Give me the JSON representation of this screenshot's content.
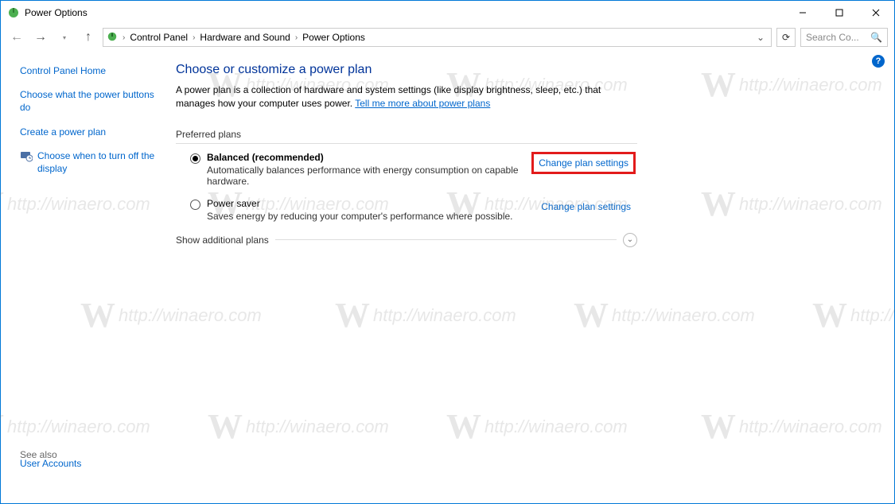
{
  "window": {
    "title": "Power Options"
  },
  "breadcrumb": {
    "seg1": "Control Panel",
    "seg2": "Hardware and Sound",
    "seg3": "Power Options"
  },
  "search": {
    "placeholder": "Search Co..."
  },
  "sidebar": {
    "home": "Control Panel Home",
    "link_buttons": "Choose what the power buttons do",
    "link_create": "Create a power plan",
    "link_turnoff": "Choose when to turn off the display",
    "see_also_label": "See also",
    "see_also_link": "User Accounts"
  },
  "content": {
    "heading": "Choose or customize a power plan",
    "desc_pre": "A power plan is a collection of hardware and system settings (like display brightness, sleep, etc.) that manages how your computer uses power. ",
    "desc_link": "Tell me more about power plans",
    "preferred_label": "Preferred plans",
    "plan1": {
      "name": "Balanced (recommended)",
      "desc": "Automatically balances performance with energy consumption on capable hardware.",
      "change": "Change plan settings"
    },
    "plan2": {
      "name": "Power saver",
      "desc": "Saves energy by reducing your computer's performance where possible.",
      "change": "Change plan settings"
    },
    "show_more": "Show additional plans"
  },
  "watermark": "http://winaero.com"
}
